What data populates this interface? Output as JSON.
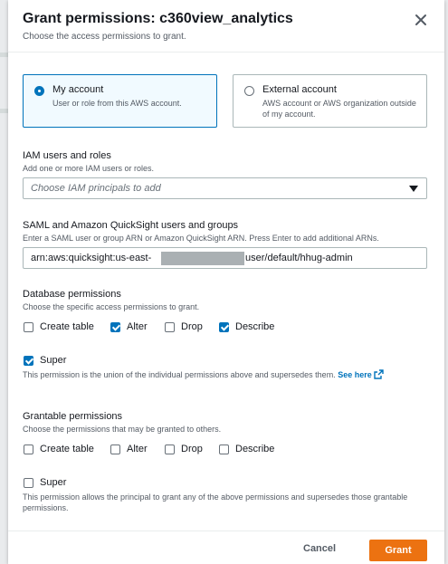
{
  "dialog": {
    "title": "Grant permissions: c360view_analytics",
    "subtitle": "Choose the access permissions to grant."
  },
  "account_options": [
    {
      "title": "My account",
      "description": "User or role from this AWS account.",
      "selected": true
    },
    {
      "title": "External account",
      "description": "AWS account or AWS organization outside of my account.",
      "selected": false
    }
  ],
  "iam": {
    "label": "IAM users and roles",
    "description": "Add one or more IAM users or roles.",
    "placeholder": "Choose IAM principals to add"
  },
  "saml": {
    "label": "SAML and Amazon QuickSight users and groups",
    "description": "Enter a SAML user or group ARN or Amazon QuickSight ARN. Press Enter to add additional ARNs.",
    "value_prefix": "arn:aws:quicksight:us-east-",
    "value_suffix": "user/default/hhug-admin"
  },
  "database_permissions": {
    "label": "Database permissions",
    "description": "Choose the specific access permissions to grant.",
    "options": [
      {
        "label": "Create table",
        "checked": false
      },
      {
        "label": "Alter",
        "checked": true
      },
      {
        "label": "Drop",
        "checked": false
      },
      {
        "label": "Describe",
        "checked": true
      }
    ],
    "super": {
      "label": "Super",
      "checked": true
    },
    "super_note": "This permission is the union of the individual permissions above and supersedes them.",
    "see_here": "See here"
  },
  "grantable_permissions": {
    "label": "Grantable permissions",
    "description": "Choose the permissions that may be granted to others.",
    "options": [
      {
        "label": "Create table",
        "checked": false
      },
      {
        "label": "Alter",
        "checked": false
      },
      {
        "label": "Drop",
        "checked": false
      },
      {
        "label": "Describe",
        "checked": false
      }
    ],
    "super": {
      "label": "Super",
      "checked": false
    },
    "super_note": "This permission allows the principal to grant any of the above permissions and supersedes those grantable permissions."
  },
  "footer": {
    "cancel_label": "Cancel",
    "grant_label": "Grant"
  },
  "colors": {
    "accent": "#0073bb",
    "primary_button": "#ec7211",
    "selected_tile_bg": "#f1faff"
  }
}
